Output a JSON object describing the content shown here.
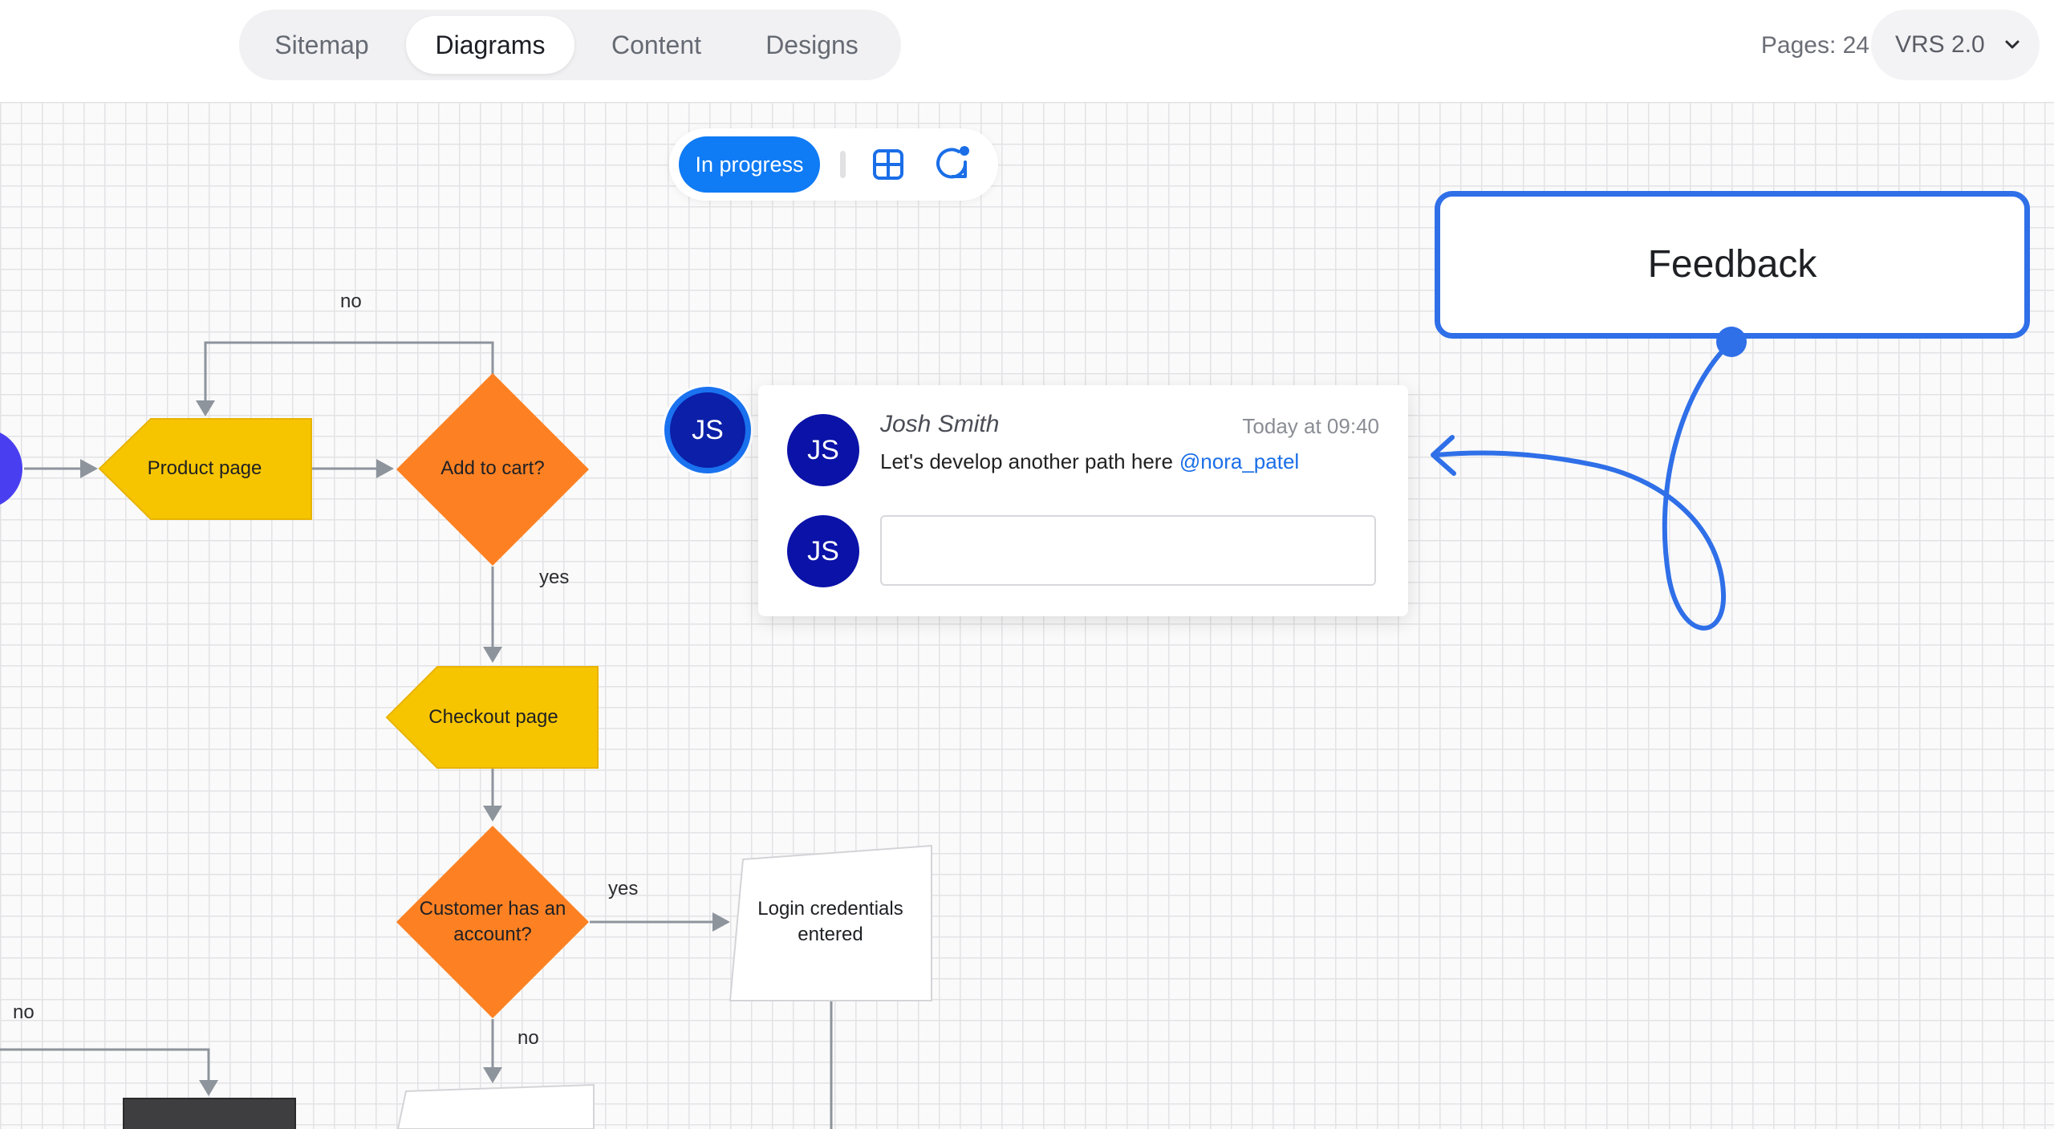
{
  "tabs": [
    {
      "label": "Sitemap",
      "active": false
    },
    {
      "label": "Diagrams",
      "active": true
    },
    {
      "label": "Content",
      "active": false
    },
    {
      "label": "Designs",
      "active": false
    }
  ],
  "header": {
    "pages_label": "Pages: 24",
    "version_label": "VRS 2.0"
  },
  "toolbar": {
    "status": "In progress",
    "icons": [
      "grid-view-icon",
      "comment-notification-icon"
    ]
  },
  "feedback": {
    "label": "Feedback"
  },
  "comment": {
    "float_avatar": "JS",
    "author_initials": "JS",
    "author": "Josh Smith",
    "time": "Today at 09:40",
    "text": "Let's develop another path here",
    "mention": "@nora_patel",
    "reply_avatar": "JS",
    "reply_value": ""
  },
  "flow": {
    "nodes": {
      "product_page": "Product page",
      "add_to_cart": "Add to cart?",
      "checkout_page": "Checkout page",
      "has_account": "Customer has an account?",
      "login_entered": "Login credentials entered"
    },
    "edges": {
      "no_top": "no",
      "yes_checkout": "yes",
      "yes_login": "yes",
      "no_bottom": "no",
      "no_left": "no"
    }
  },
  "colors": {
    "accent": "#0f7bf5",
    "feedback_border": "#2f6fe8",
    "avatar": "#0b12a8",
    "page_node": "#f7c500",
    "decision_node": "#fd8123",
    "start_node": "#4a3ff0",
    "end_node": "#3e3e40",
    "connector": "#8e949c"
  }
}
